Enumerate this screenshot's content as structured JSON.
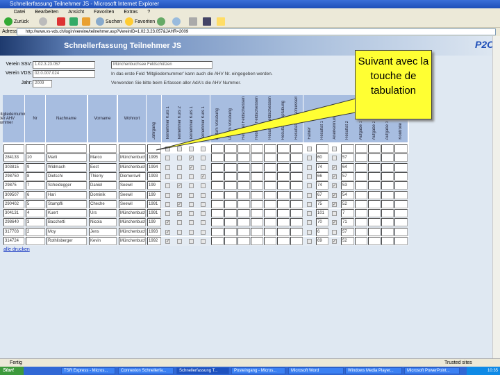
{
  "window": {
    "title": "Schnellerfassung Teilnehmer JS - Microsoft Internet Explorer"
  },
  "menu": [
    "Datei",
    "Bearbeiten",
    "Ansicht",
    "Favoriten",
    "Extras",
    "?"
  ],
  "toolbar": {
    "back": "Zurück",
    "search": "Suchen",
    "favorites": "Favoriten"
  },
  "address": {
    "label": "Adresse",
    "url": "http://www.vs-vds.ch/login/vereine/teilnehmer.asp?VereinID=1.02.3.23.057&JAHR=2009"
  },
  "banner": {
    "title": "Schnellerfassung Teilnehmer JS",
    "logo": "P2O"
  },
  "form": {
    "ssv_label": "Verein SSV:",
    "ssv_value": "1.02.3.23.057",
    "vds_label": "Verein VDS:",
    "vds_value": "02.0.007.024",
    "year_label": "Jahr:",
    "year_value": "2009",
    "club_name": "Münchenbuchsee Feldschützen",
    "note1": "In das erste Feld 'Mitgliedernummer' kann auch die AHV Nr. eingegeben werden.",
    "note2": "Verwenden Sie bitte beim Erfassen aller AdA's die AHV Nummer."
  },
  "table": {
    "headers": [
      "Mitgliedernummer oder AHV Nummer",
      "Nr",
      "Nachname",
      "Vorname",
      "Wohnort",
      "Jahrgang",
      "Teilnehmer Kurs 1",
      "Teilnehmer Kurs 2",
      "Teilnehmer Kurs 1",
      "Teilnehmer Kurs 1",
      "Datum Vorübung",
      "Datum Vorübung",
      "Resultat Feldschiessen",
      "Resultat Feldschiessen",
      "Resultat Feldschiessen",
      "Resultat Hauptübung",
      "Resultat Wettschiessen",
      "Fahrer",
      "Resultat 1",
      "Anerkennung",
      "Resultat 2",
      "Aufgabe 1",
      "Aufgabe 2",
      "Aufgabe 3",
      "Kontrolle"
    ],
    "rows": [
      {
        "id": "284133",
        "nr": "10",
        "last": "Marti",
        "first": "Marco",
        "town": "Münchenbuchsee",
        "year": "1995",
        "kurs": [
          false,
          false,
          true,
          false
        ],
        "r1": "60",
        "ok": false,
        "r2": "57"
      },
      {
        "id": "303815",
        "nr": "9",
        "last": "Widmach",
        "first": "Eest",
        "town": "Münchenbuchsee",
        "year": "1994",
        "kurs": [
          false,
          false,
          true,
          false
        ],
        "r1": "74",
        "ok": true,
        "r2": "64"
      },
      {
        "id": "298750",
        "nr": "8",
        "last": "Dietschi",
        "first": "Thierry",
        "town": "Diemerswil",
        "year": "1993",
        "kurs": [
          false,
          false,
          false,
          true
        ],
        "r1": "66",
        "ok": true,
        "r2": "57"
      },
      {
        "id": "29875",
        "nr": "7",
        "last": "Scheidegger",
        "first": "Daniel",
        "town": "Seewil",
        "year": "199",
        "kurs": [
          false,
          true,
          false,
          false
        ],
        "r1": "74",
        "ok": true,
        "r2": "53"
      },
      {
        "id": "309507",
        "nr": "6",
        "last": "Hari",
        "first": "Dominik",
        "town": "Seewil",
        "year": "199",
        "kurs": [
          false,
          true,
          false,
          false
        ],
        "r1": "67",
        "ok": true,
        "r2": "54"
      },
      {
        "id": "290402",
        "nr": "5",
        "last": "Stampfli",
        "first": "Cheche",
        "town": "Seewil",
        "year": "1991",
        "kurs": [
          false,
          true,
          false,
          false
        ],
        "r1": "75",
        "ok": true,
        "r2": "52"
      },
      {
        "id": "304131",
        "nr": "4",
        "last": "Kuert",
        "first": "Urs",
        "town": "Münchenbuchsee",
        "year": "1991",
        "kurs": [
          false,
          true,
          false,
          false
        ],
        "r1": "101",
        "ok": false,
        "r2": "7"
      },
      {
        "id": "298640",
        "nr": "3",
        "last": "Bacchetti",
        "first": "Nicola",
        "town": "Münchenbuchsee",
        "year": "199",
        "kurs": [
          true,
          false,
          false,
          false
        ],
        "r1": "70",
        "ok": true,
        "r2": "71"
      },
      {
        "id": "317703",
        "nr": "2",
        "last": "Moy",
        "first": "Jens",
        "town": "Münchenbuchsee",
        "year": "1993",
        "kurs": [
          true,
          false,
          false,
          false
        ],
        "r1": "6",
        "ok": false,
        "r2": "57"
      },
      {
        "id": "314724",
        "nr": "",
        "last": "Rothlisberger",
        "first": "Kevin",
        "town": "Münchenbuchsee",
        "year": "1992",
        "kurs": [
          true,
          false,
          false,
          false
        ],
        "r1": "69",
        "ok": true,
        "r2": "52"
      }
    ],
    "print_link": "alle drucken"
  },
  "callout": {
    "text": "Suivant avec la touche de tabulation",
    "color": "#ffff33"
  },
  "status": {
    "text": "Fertig",
    "zone": "Trusted sites"
  },
  "taskbar": {
    "start": "Start",
    "items": [
      "TSR Express - Micros...",
      "Connexion Schnellerfa...",
      "Schnellerfassung T...",
      "Posteingang - Micros...",
      "Microsoft Word",
      "Windows Media Player...",
      "Microsoft PowerPoint..."
    ],
    "clock": "10:35"
  }
}
